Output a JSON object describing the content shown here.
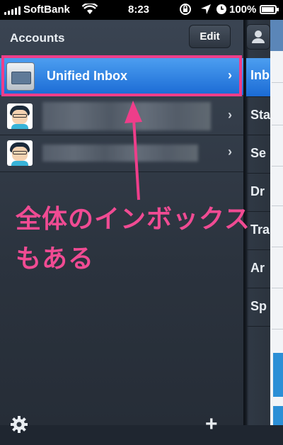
{
  "status_bar": {
    "carrier": "SoftBank",
    "time": "8:23",
    "battery": "100%"
  },
  "accounts": {
    "title": "Accounts",
    "edit_label": "Edit",
    "unified_inbox_label": "Unified Inbox"
  },
  "mailboxes": {
    "items": [
      "Inb",
      "Sta",
      "Se",
      "Dr",
      "Tra",
      "Ar",
      "Sp"
    ]
  },
  "annotation": {
    "text": "全体のインボックス\nもある"
  },
  "colors": {
    "accent": "#1b6bd5",
    "annotation": "#f04b93"
  }
}
